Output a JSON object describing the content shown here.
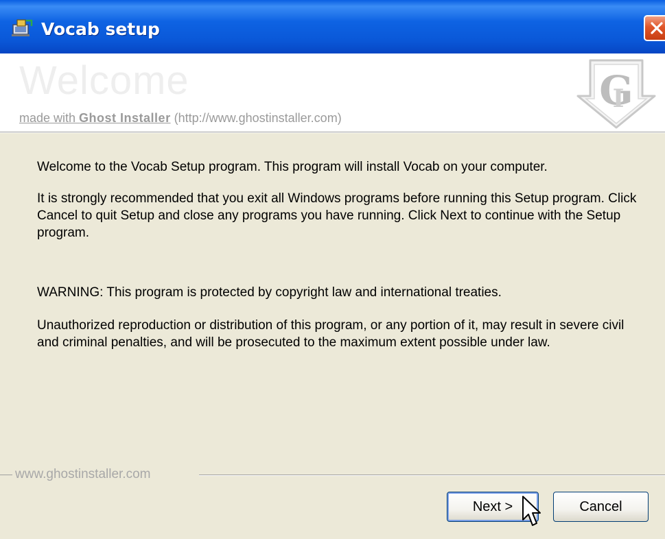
{
  "window": {
    "title": "Vocab setup"
  },
  "icons": {
    "app": "installer-icon",
    "close": "close-icon",
    "logo": "ghost-installer-logo-icon",
    "cursor": "mouse-pointer-icon"
  },
  "header": {
    "welcome": "Welcome",
    "made_with_prefix": "made with ",
    "brand_link": "Ghost Installer",
    "url": "(http://www.ghostinstaller.com)"
  },
  "body": {
    "p1": "Welcome to the Vocab Setup program. This program will install Vocab on your computer.",
    "p2": "It is strongly recommended that you exit all Windows programs before running this Setup program. Click Cancel to quit Setup and close any programs you have running. Click Next to continue with the Setup program.",
    "p3": "WARNING: This program is protected by copyright law and international treaties.",
    "p4": "Unauthorized reproduction or distribution of this program, or any portion of it, may result in severe civil and criminal penalties, and will be prosecuted to the maximum extent possible under law."
  },
  "footer": {
    "brand": "www.ghostinstaller.com"
  },
  "buttons": {
    "next": "Next >",
    "cancel": "Cancel"
  },
  "colors": {
    "titlebar": "#0a58d8",
    "dialog_bg": "#ece9d8",
    "close_button": "#e0562a"
  }
}
